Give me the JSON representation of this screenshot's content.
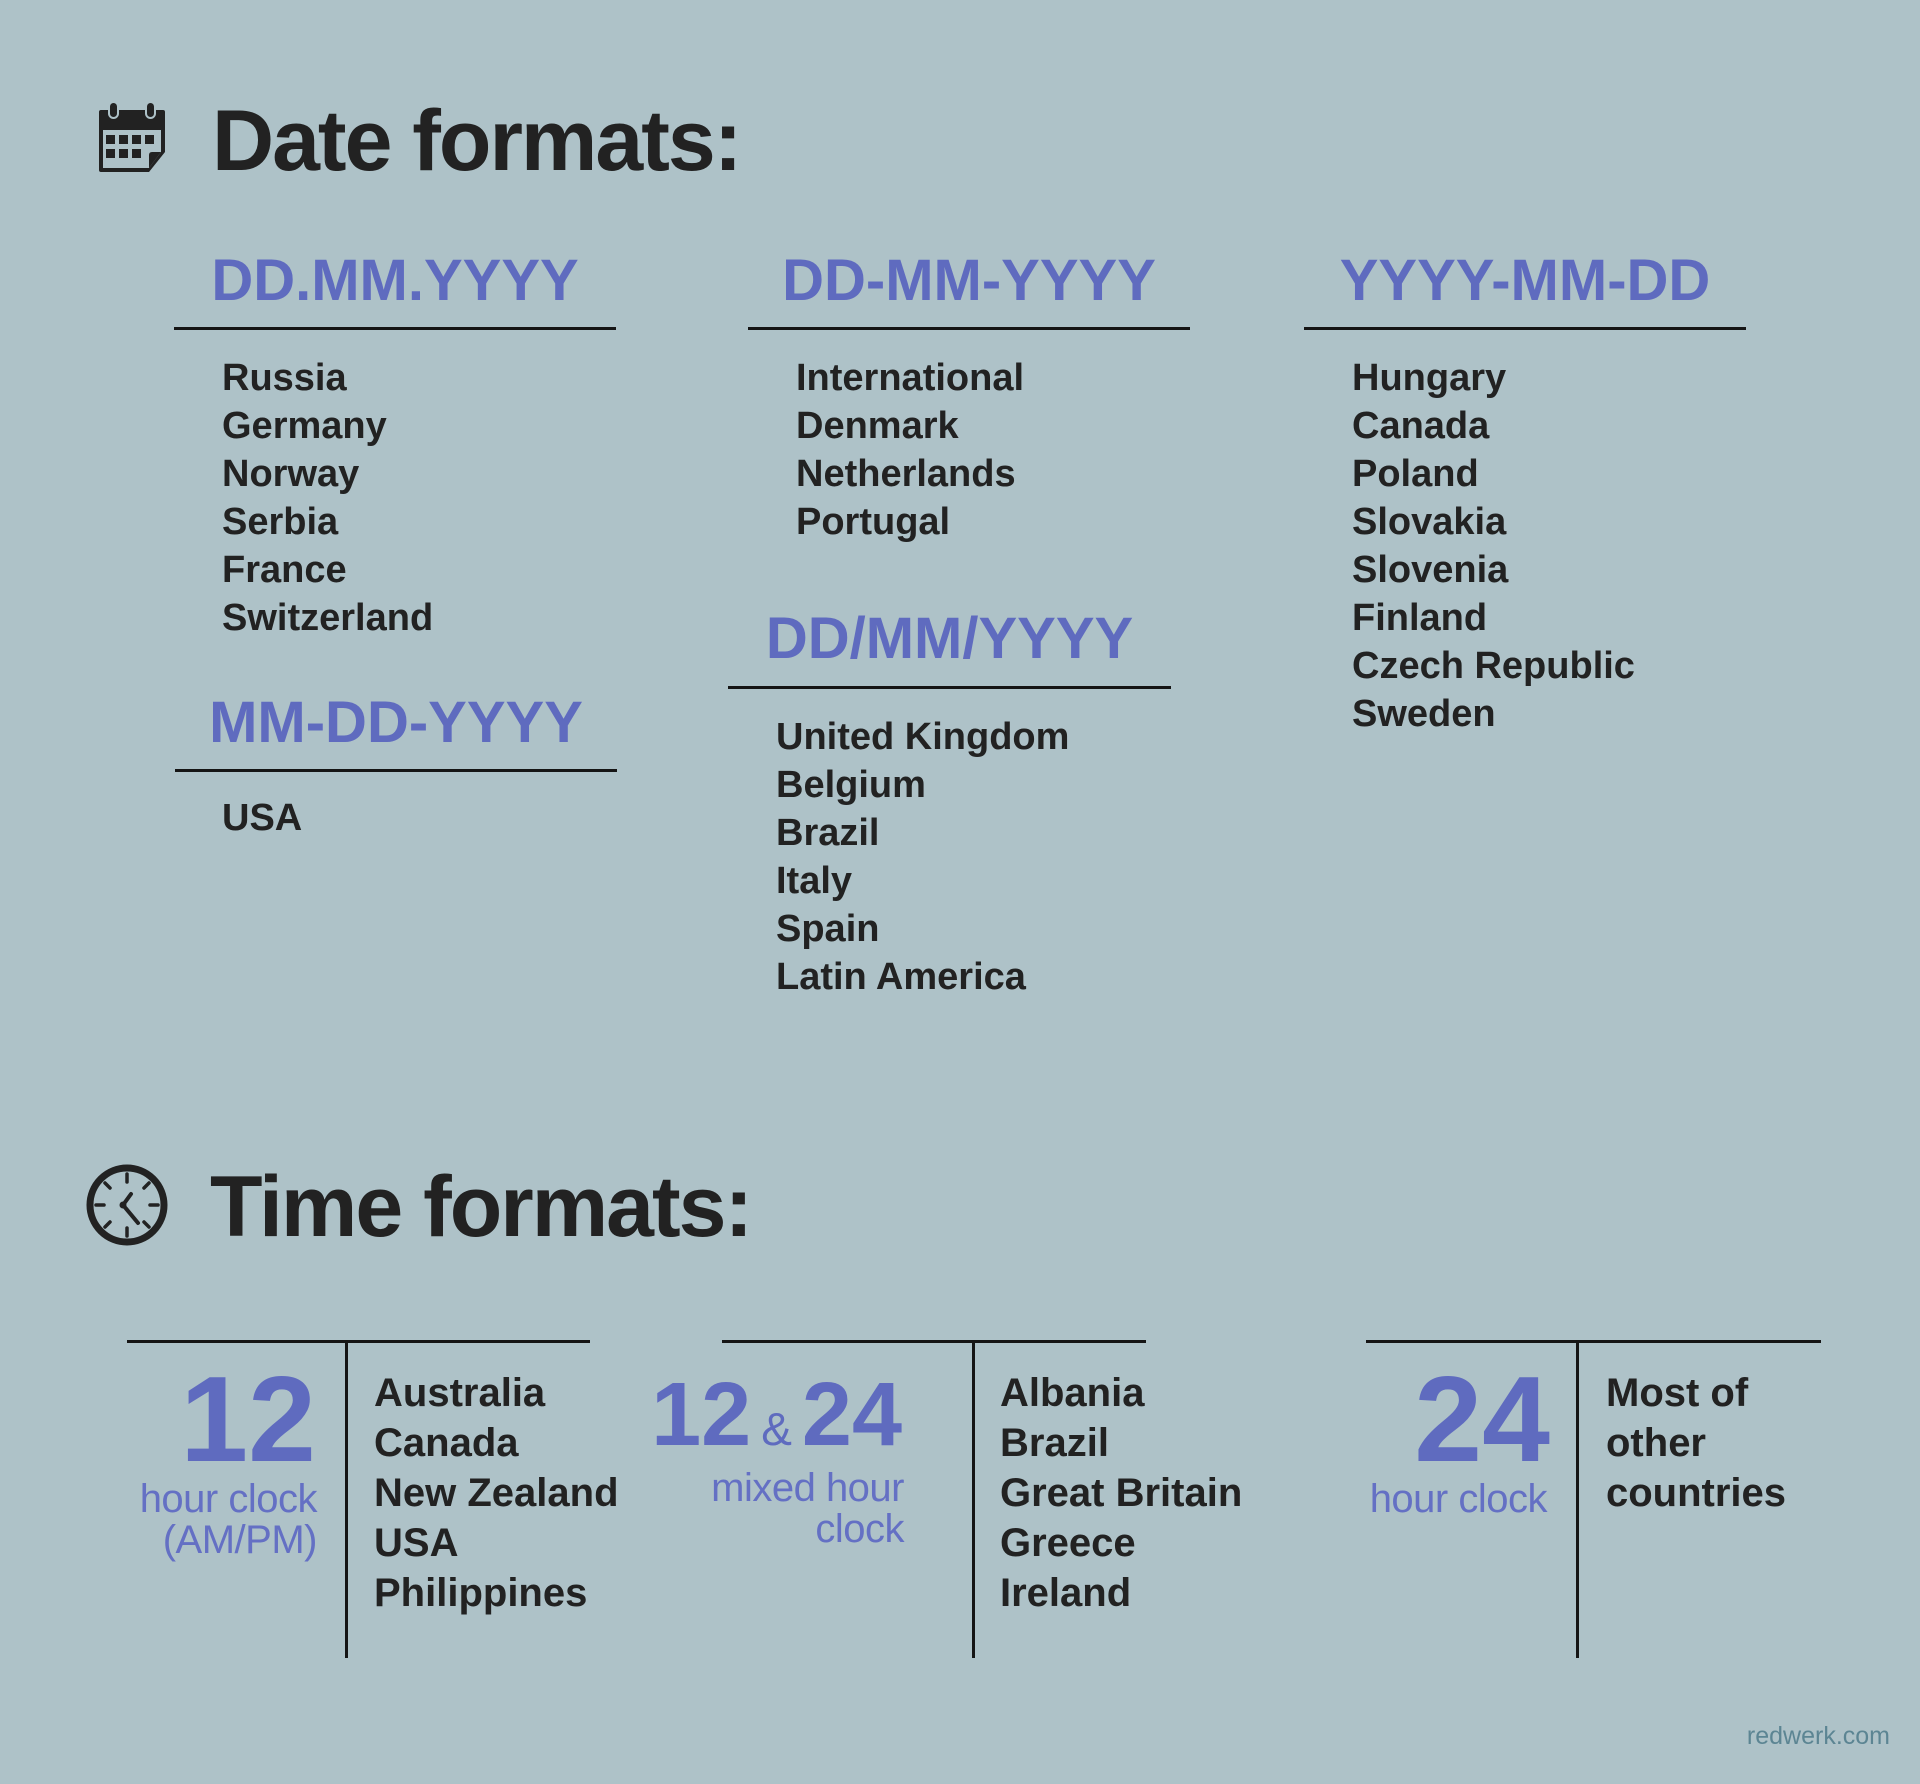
{
  "date_section": {
    "title": "Date formats:",
    "icon": "calendar-icon",
    "formats": [
      {
        "label": "DD.MM.YYYY",
        "countries": [
          "Russia",
          "Germany",
          "Norway",
          "Serbia",
          "France",
          "Switzerland"
        ]
      },
      {
        "label": "MM-DD-YYYY",
        "countries": [
          "USA"
        ]
      },
      {
        "label": "DD-MM-YYYY",
        "countries": [
          "International",
          "Denmark",
          "Netherlands",
          "Portugal"
        ]
      },
      {
        "label": "DD/MM/YYYY",
        "countries": [
          "United Kingdom",
          "Belgium",
          "Brazil",
          "Italy",
          "Spain",
          "Latin America"
        ]
      },
      {
        "label": "YYYY-MM-DD",
        "countries": [
          "Hungary",
          "Canada",
          "Poland",
          "Slovakia",
          "Slovenia",
          "Finland",
          "Czech Republic",
          "Sweden"
        ]
      }
    ]
  },
  "time_section": {
    "title": "Time formats:",
    "icon": "clock-icon",
    "formats": [
      {
        "number": "12",
        "caption_lines": [
          "hour clock",
          "(AM/PM)"
        ],
        "countries": [
          "Australia",
          "Canada",
          "New Zealand",
          "USA",
          "Philippines"
        ]
      },
      {
        "number_a": "12",
        "conjunction": "&",
        "number_b": "24",
        "caption_lines": [
          "mixed hour",
          "clock"
        ],
        "countries": [
          "Albania",
          "Brazil",
          "Great Britain",
          "Greece",
          "Ireland"
        ]
      },
      {
        "number": "24",
        "caption_lines": [
          "hour clock"
        ],
        "countries": [
          "Most of",
          "other",
          "countries"
        ]
      }
    ]
  },
  "footer": {
    "credit": "redwerk.com"
  },
  "colors": {
    "background": "#aec2c8",
    "accent": "#5f6bbf",
    "text": "#222222",
    "footer": "#5c8593"
  }
}
